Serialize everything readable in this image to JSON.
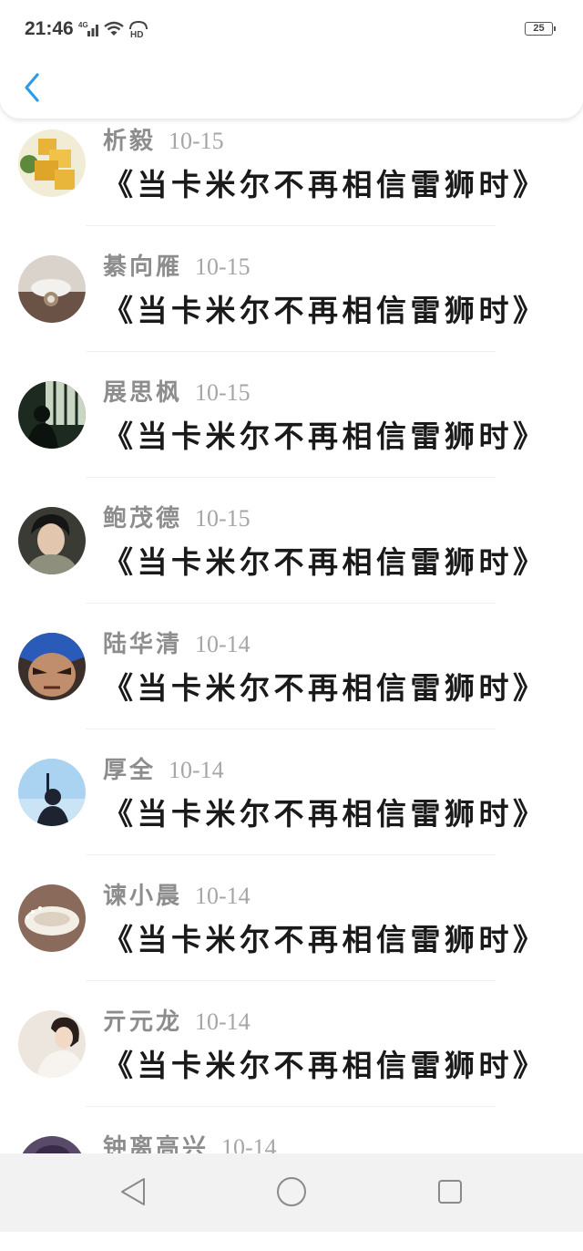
{
  "status": {
    "time": "21:46",
    "battery": "25",
    "network": "4G",
    "hd": "HD"
  },
  "header": {
    "back_icon": "chevron-left-icon",
    "accent": "#2f9be6"
  },
  "comments": [
    {
      "name": "析毅",
      "date": "10-15",
      "message": "《当卡米尔不再相信雷狮时》"
    },
    {
      "name": "綦向雁",
      "date": "10-15",
      "message": "《当卡米尔不再相信雷狮时》"
    },
    {
      "name": "展思枫",
      "date": "10-15",
      "message": "《当卡米尔不再相信雷狮时》"
    },
    {
      "name": "鲍茂德",
      "date": "10-15",
      "message": "《当卡米尔不再相信雷狮时》"
    },
    {
      "name": "陆华清",
      "date": "10-14",
      "message": "《当卡米尔不再相信雷狮时》"
    },
    {
      "name": "厚全",
      "date": "10-14",
      "message": "《当卡米尔不再相信雷狮时》"
    },
    {
      "name": "谏小晨",
      "date": "10-14",
      "message": "《当卡米尔不再相信雷狮时》"
    },
    {
      "name": "亓元龙",
      "date": "10-14",
      "message": "《当卡米尔不再相信雷狮时》"
    },
    {
      "name": "钟离高兴",
      "date": "10-14",
      "message": ""
    }
  ],
  "navbar": {
    "back": "triangle-back-icon",
    "home": "circle-home-icon",
    "recents": "square-recents-icon"
  }
}
